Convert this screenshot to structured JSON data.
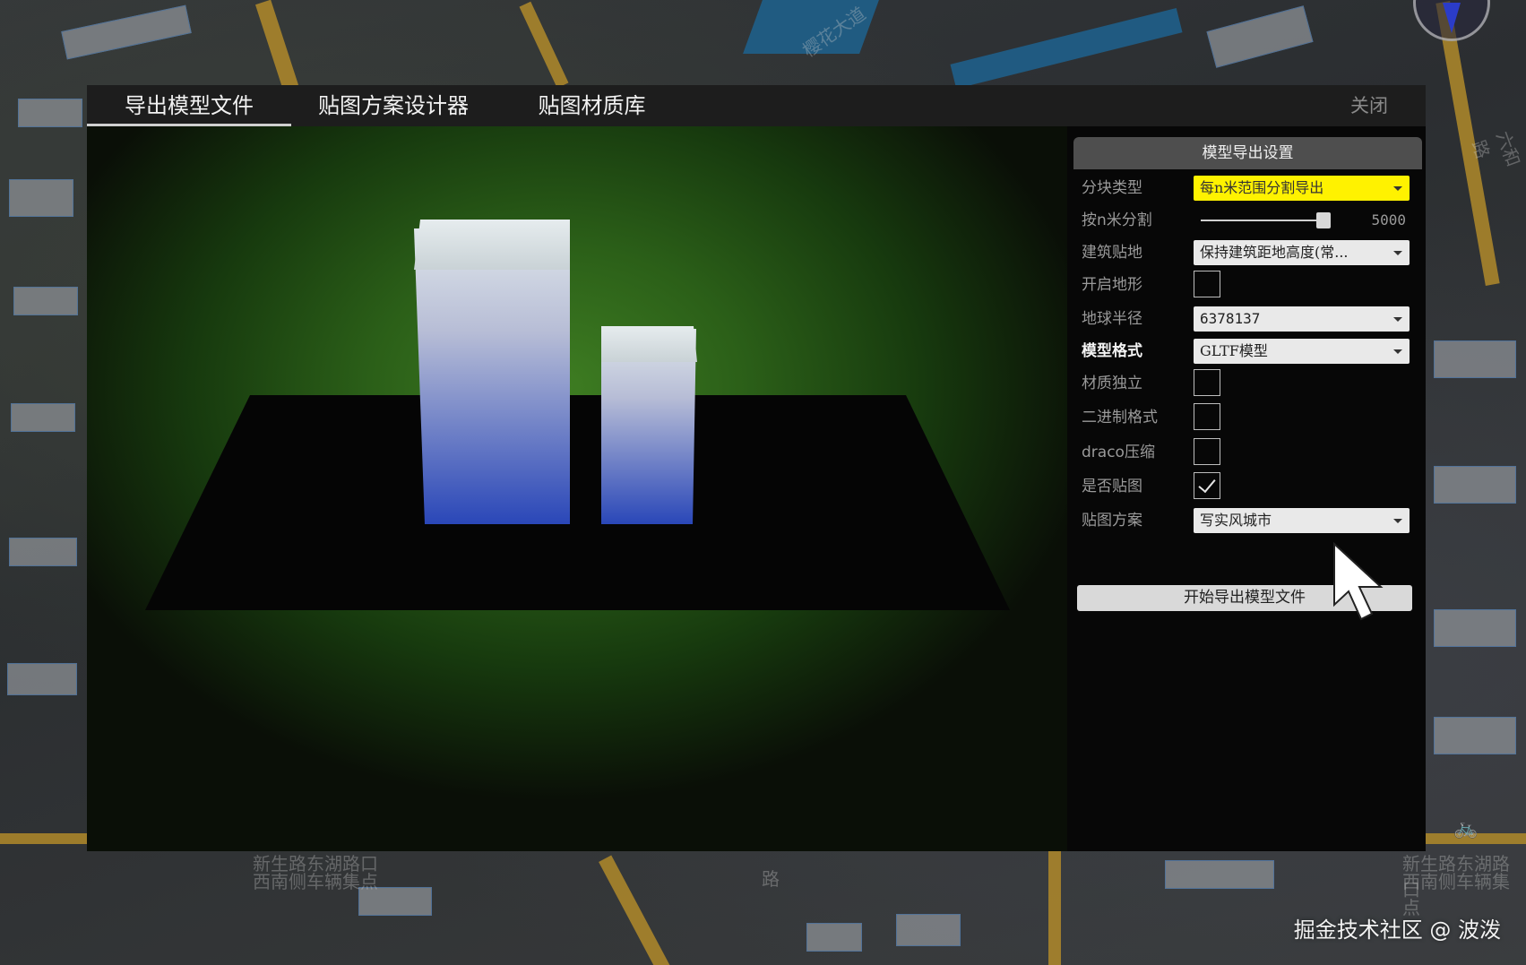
{
  "tabs": [
    {
      "label": "导出模型文件",
      "active": true
    },
    {
      "label": "贴图方案设计器",
      "active": false
    },
    {
      "label": "贴图材质库",
      "active": false
    }
  ],
  "close_label": "关闭",
  "panel": {
    "title": "模型导出设置",
    "block_type": {
      "label": "分块类型",
      "value": "每n米范围分割导出"
    },
    "split_by_n": {
      "label": "按n米分割",
      "value": "5000"
    },
    "building_clamp": {
      "label": "建筑贴地",
      "value": "保持建筑距地高度(常..."
    },
    "enable_terrain": {
      "label": "开启地形",
      "checked": false
    },
    "earth_radius": {
      "label": "地球半径",
      "value": "6378137"
    },
    "model_format": {
      "label": "模型格式",
      "value": "GLTF模型"
    },
    "separate_material": {
      "label": "材质独立",
      "checked": false
    },
    "binary_format": {
      "label": "二进制格式",
      "checked": false
    },
    "draco": {
      "label": "draco压缩",
      "checked": false
    },
    "apply_texture": {
      "label": "是否贴图",
      "checked": true
    },
    "texture_scheme": {
      "label": "贴图方案",
      "value": "写实风城市"
    },
    "export_button": "开始导出模型文件"
  },
  "map": {
    "labels": [
      "新生路东湖路口",
      "西南侧车辆集点",
      "新生路东湖路口",
      "西南侧车辆集点",
      "六和路",
      "樱花大道",
      "路"
    ]
  },
  "watermark": "掘金技术社区 @ 波泼",
  "colors": {
    "accent_yellow": "#fff200",
    "viewport_green": "#3e7d22",
    "building_top": "#dfe6ea",
    "building_bottom": "#2a47b8"
  }
}
